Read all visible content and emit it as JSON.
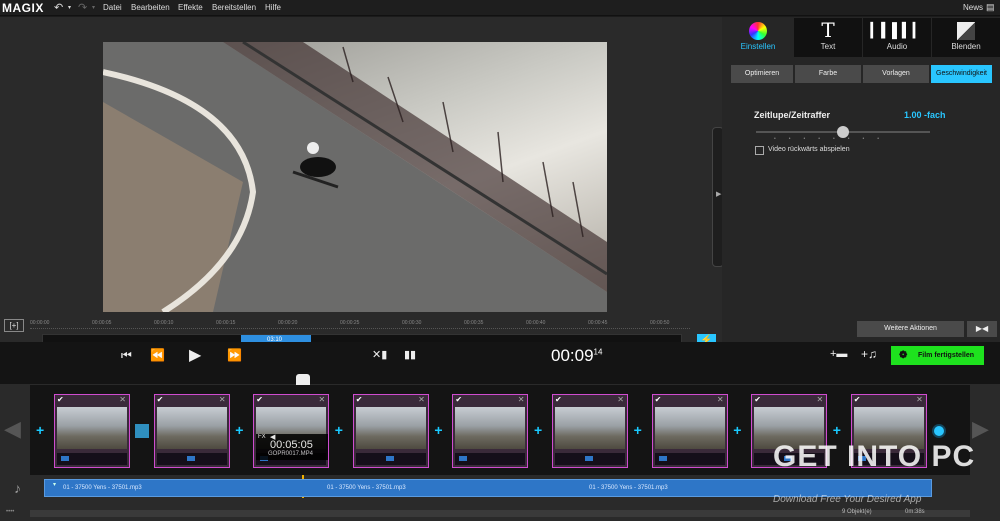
{
  "menubar": {
    "logo": "MAGIX",
    "items": [
      "Datei",
      "Bearbeiten",
      "Effekte",
      "Bereitstellen",
      "Hilfe"
    ],
    "news": "News"
  },
  "preview": {
    "ruler_ticks": [
      "00:00:00",
      "00:00:05",
      "00:00:10",
      "00:00:15",
      "00:00:20",
      "00:00:25",
      "00:00:30",
      "00:00:35",
      "00:00:40",
      "00:00:45",
      "00:00:50"
    ],
    "scrub_time": "03:10",
    "scrub_progress": 0.44
  },
  "rightpanel": {
    "tabs": [
      {
        "label": "Einstellen",
        "icon": "color-wheel-icon"
      },
      {
        "label": "Text",
        "icon": "text-icon"
      },
      {
        "label": "Audio",
        "icon": "audio-waveform-icon"
      },
      {
        "label": "Blenden",
        "icon": "transition-icon"
      }
    ],
    "subtabs": [
      "Optimieren",
      "Farbe",
      "Vorlagen",
      "Geschwindigkeit"
    ],
    "speed_label": "Zeitlupe/Zeitraffer",
    "speed_value": "1.00 -fach",
    "speed_level": 0.5,
    "reverse_label": "Video rückwärts abspielen",
    "more_button": "Weitere Aktionen"
  },
  "transport": {
    "time": "00:09",
    "frames": "14",
    "finish_button": "Film fertigstellen"
  },
  "timeline": {
    "clip_count": 9,
    "fx_label": "FX",
    "clip_time": "00:05:05",
    "clip_name": "GOPR0017.MP4",
    "audio_labels": [
      "01 - 37500 Yens - 37501.mp3",
      "01 - 37500 Yens - 37501.mp3",
      "01 - 37500 Yens - 37501.mp3"
    ],
    "status_objects": "9 Objekt(e)",
    "status_time": "0m:38s"
  },
  "watermark": {
    "title": "GET INTO PC",
    "subtitle": "Download Free Your Desired App"
  },
  "colors": {
    "accent": "#29c6ff",
    "finish": "#1ee21e",
    "clip_border": "#d04cd0",
    "audio": "#2e76c7"
  }
}
